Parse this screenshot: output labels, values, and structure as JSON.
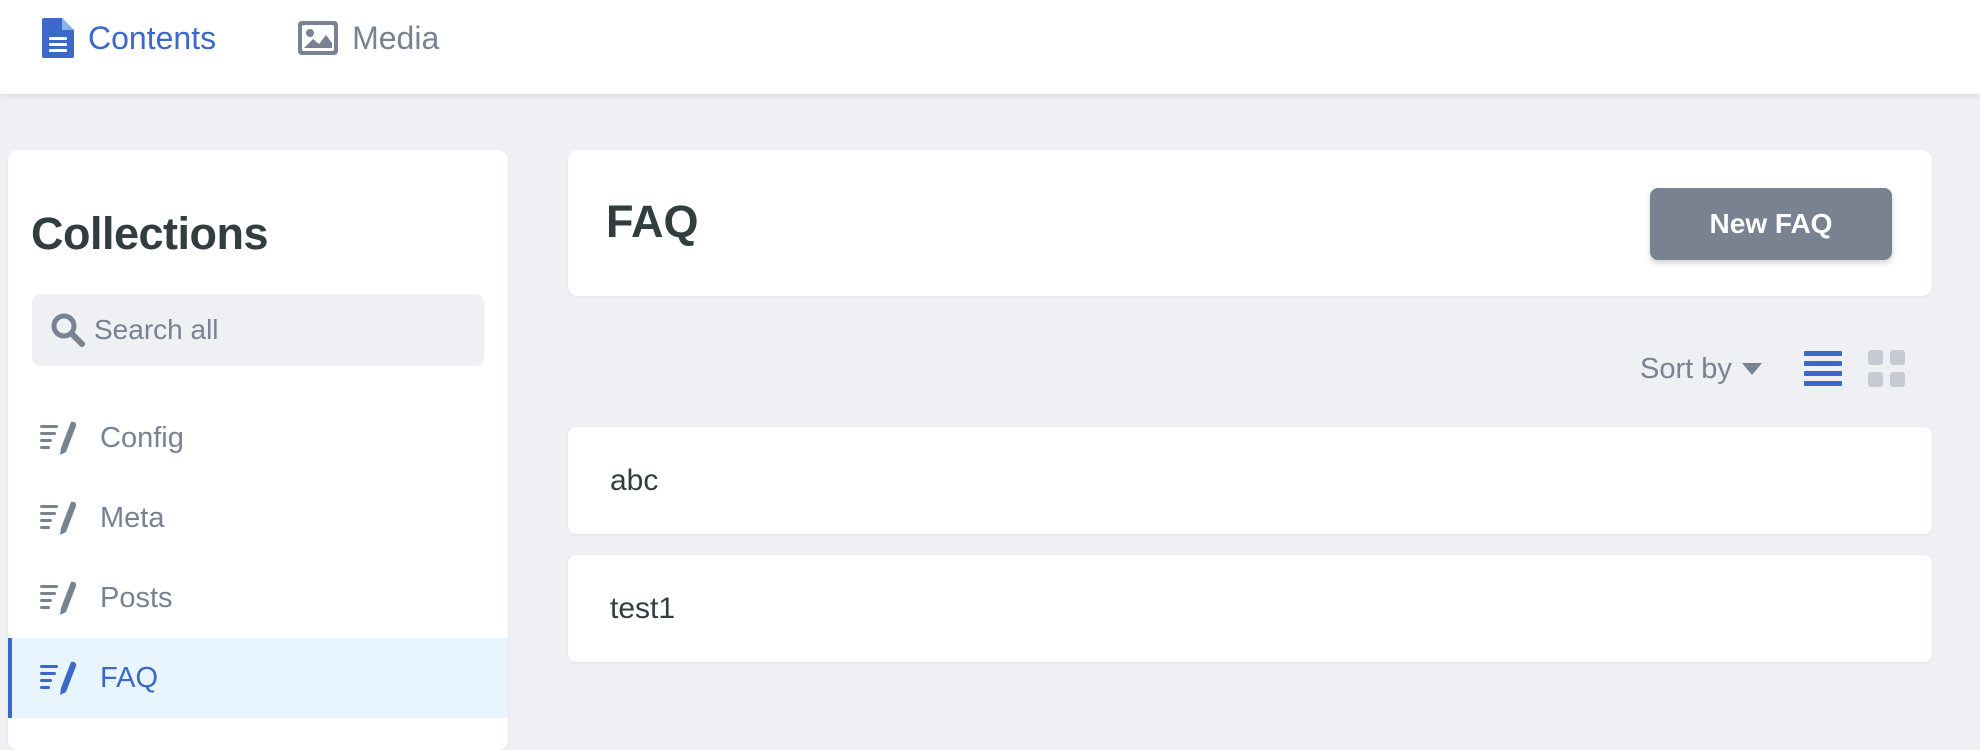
{
  "nav": {
    "tabs": [
      {
        "label": "Contents",
        "icon": "file-text-icon",
        "active": true
      },
      {
        "label": "Media",
        "icon": "image-icon",
        "active": false
      }
    ]
  },
  "sidebar": {
    "title": "Collections",
    "search": {
      "placeholder": "Search all",
      "value": "",
      "icon": "search-icon"
    },
    "items": [
      {
        "label": "Config",
        "icon": "write-icon",
        "active": false
      },
      {
        "label": "Meta",
        "icon": "write-icon",
        "active": false
      },
      {
        "label": "Posts",
        "icon": "write-icon",
        "active": false
      },
      {
        "label": "FAQ",
        "icon": "write-icon",
        "active": true
      }
    ]
  },
  "main": {
    "title": "FAQ",
    "new_button_label": "New FAQ",
    "sort_label": "Sort by",
    "view_mode": "list",
    "entries": [
      {
        "title": "abc"
      },
      {
        "title": "test1"
      }
    ]
  },
  "colors": {
    "accent": "#3a69c7",
    "muted": "#798291",
    "text": "#313d3e",
    "background": "#eff0f4",
    "active_bg": "#e8f5fe"
  }
}
